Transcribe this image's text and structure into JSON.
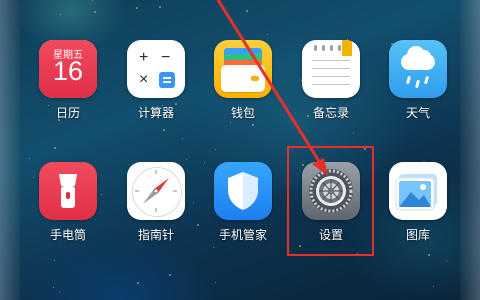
{
  "calendar": {
    "weekday": "星期五",
    "day": "16"
  },
  "apps": {
    "calendar": "日历",
    "calculator": "计算器",
    "wallet": "钱包",
    "notes": "备忘录",
    "weather": "天气",
    "flashlight": "手电筒",
    "compass": "指南针",
    "phone_manager": "手机管家",
    "settings": "设置",
    "gallery": "图库"
  },
  "annotation": {
    "color": "#e8302a"
  }
}
